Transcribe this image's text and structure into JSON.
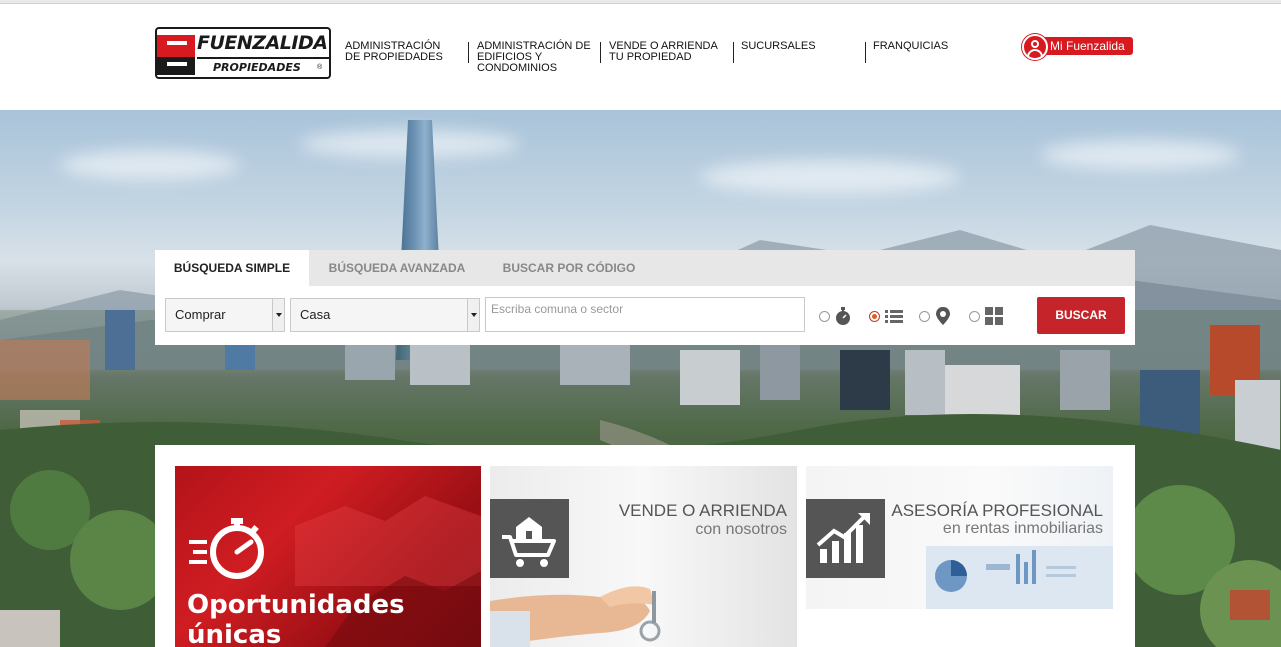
{
  "brand": {
    "name": "FUENZALIDA",
    "sub": "PROPIEDADES",
    "registered": "®"
  },
  "nav": [
    {
      "label": "ADMINISTRACIÓN DE PROPIEDADES"
    },
    {
      "label": "ADMINISTRACIÓN DE EDIFICIOS Y CONDOMINIOS"
    },
    {
      "label": "VENDE O ARRIENDA TU PROPIEDAD"
    },
    {
      "label": "SUCURSALES"
    },
    {
      "label": "FRANQUICIAS"
    }
  ],
  "account": {
    "label": "Mi Fuenzalida",
    "icon": "user-icon"
  },
  "search": {
    "tabs": [
      {
        "label": "BÚSQUEDA SIMPLE",
        "active": true
      },
      {
        "label": "BÚSQUEDA AVANZADA",
        "active": false
      },
      {
        "label": "BUSCAR POR CÓDIGO",
        "active": false
      }
    ],
    "operation": "Comprar",
    "property_type": "Casa",
    "location_placeholder": "Escriba comuna o sector",
    "view_options": [
      {
        "icon": "stopwatch-icon",
        "selected": false
      },
      {
        "icon": "list-icon",
        "selected": true
      },
      {
        "icon": "map-pin-icon",
        "selected": false
      },
      {
        "icon": "grid-icon",
        "selected": false
      }
    ],
    "submit_label": "BUSCAR"
  },
  "features": [
    {
      "title": "Oportunidades únicas",
      "icon": "stopwatch-icon"
    },
    {
      "title": "VENDE O ARRIENDA",
      "subtitle": "con nosotros",
      "icon": "house-cart-icon"
    },
    {
      "title": "ASESORÍA PROFESIONAL",
      "subtitle": "en rentas inmobiliarias",
      "icon": "growth-chart-icon"
    }
  ],
  "colors": {
    "accent": "#c5252a",
    "brand_red": "#d71920",
    "dark": "#1a1a1a"
  }
}
